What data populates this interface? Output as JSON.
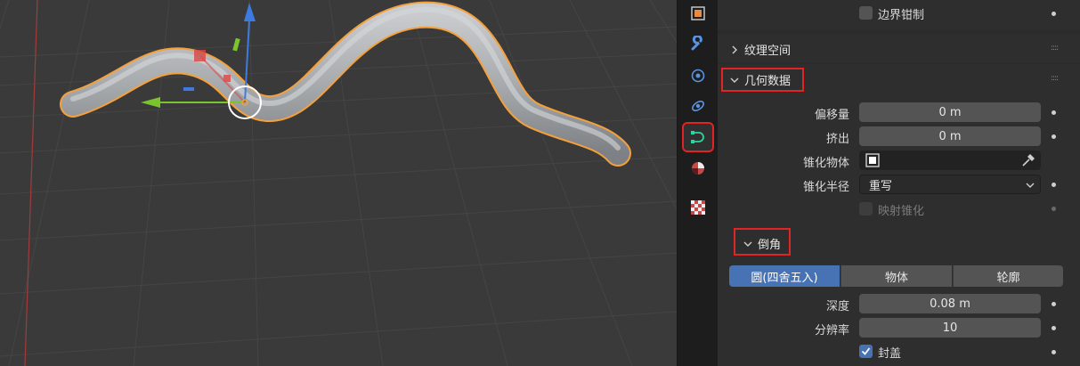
{
  "tabs": [
    {
      "name": "object-tab",
      "icon": "object-icon",
      "color": "#e98a43",
      "active": false
    },
    {
      "name": "modifier-tab",
      "icon": "wrench-icon",
      "color": "#5a93e0",
      "active": false
    },
    {
      "name": "particles-tab",
      "icon": "particles-icon",
      "color": "#5a93e0",
      "active": false
    },
    {
      "name": "physics-tab",
      "icon": "physics-icon",
      "color": "#5a93e0",
      "active": false
    },
    {
      "name": "curve-data-tab",
      "icon": "curve-icon",
      "color": "#27d6a0",
      "active": true
    },
    {
      "name": "material-tab",
      "icon": "material-icon",
      "color": "#e05050",
      "active": false
    },
    {
      "name": "texture-tab",
      "icon": "texture-icon",
      "color": "#e05050",
      "active": false
    }
  ],
  "panel": {
    "clamp_label": "边界钳制",
    "texture_space_label": "纹理空间",
    "geometry": {
      "title": "几何数据",
      "offset_label": "偏移量",
      "offset_value": "0 m",
      "extrude_label": "挤出",
      "extrude_value": "0 m",
      "taper_object_label": "锥化物体",
      "taper_radius_label": "锥化半径",
      "taper_radius_value": "重写",
      "map_taper_label": "映射锥化"
    },
    "bevel": {
      "title": "倒角",
      "modes": [
        "圆(四舍五入)",
        "物体",
        "轮廓"
      ],
      "active_mode": 0,
      "depth_label": "深度",
      "depth_value": "0.08 m",
      "resolution_label": "分辨率",
      "resolution_value": "10",
      "fill_caps_label": "封盖",
      "fill_caps_checked": true
    }
  },
  "colors": {
    "accent": "#4772b3",
    "highlight_box": "#e02525",
    "selection_outline": "#f5a03a"
  }
}
